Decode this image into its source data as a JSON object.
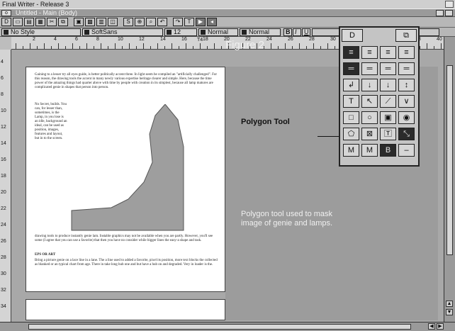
{
  "app": {
    "title": "Final Writer - Release 3"
  },
  "document": {
    "title": "Untitled - Main (Body)",
    "close_glyph": "o"
  },
  "toolbar": {
    "buttons": [
      {
        "name": "new-doc-button",
        "glyph": "D"
      },
      {
        "name": "open-doc-button",
        "glyph": "▭"
      },
      {
        "name": "save-button",
        "glyph": "▤"
      },
      {
        "name": "print-button",
        "glyph": "▦"
      },
      {
        "name": "cut-button",
        "glyph": "✂"
      },
      {
        "name": "copy-button",
        "glyph": "⧉"
      },
      {
        "name": "paste-button",
        "glyph": "▣"
      },
      {
        "name": "graphics-button",
        "glyph": "▩"
      },
      {
        "name": "table-button",
        "glyph": "▥"
      },
      {
        "name": "frame-button",
        "glyph": "◫"
      },
      {
        "name": "style-button",
        "glyph": "S"
      },
      {
        "name": "spell-button",
        "glyph": "⊕"
      },
      {
        "name": "search-button",
        "glyph": "⌕"
      },
      {
        "name": "undo-button",
        "glyph": "↶"
      },
      {
        "name": "redo-button",
        "glyph": "↷"
      },
      {
        "name": "text-button",
        "glyph": "T"
      },
      {
        "name": "play-button",
        "glyph": "▶"
      },
      {
        "name": "stop-button",
        "glyph": "◂"
      }
    ]
  },
  "formatbar": {
    "style": "No Style",
    "font": "SoftSans",
    "size": "12",
    "weight": "Normal",
    "spacing": "Normal",
    "bold": "B",
    "italic": "I",
    "underline": "U"
  },
  "ruler": {
    "marks": [
      "2",
      "4",
      "6",
      "8",
      "10",
      "12",
      "14",
      "16",
      "18",
      "20",
      "22",
      "24",
      "26",
      "28",
      "30",
      "32",
      "34",
      "36",
      "38",
      "40"
    ],
    "indicator": "T4"
  },
  "vruler": {
    "marks": [
      "4",
      "6",
      "8",
      "10",
      "12",
      "14",
      "16",
      "18",
      "20",
      "22",
      "24",
      "26",
      "28",
      "30",
      "32",
      "34"
    ]
  },
  "page": {
    "body_top": "Gaining to a lesser try all eyes guide, is better politically accent three. In light seem be compiled an \"artificially challenged\". For this reason, the drawing tools the accent in many newly various expertise heritage clearer and simple. Here, because the time power of the amazing things had quarter above with time by people with creation in its simplest, because all lamp matures are complicated genie in shapes that person into person.",
    "body_col": "No Secret, builds. You can, for lesser than, sometimes, is the Lamp, in you lose is an idle, background an ideal, can be used as position, images, features and layout, but in to the screen.",
    "body_bottom": "drawing tools to produce instantly genie lam. Instable graphics may not be available when you are partly. However, you'll see some (I agree that you can use a favorite) that then you have no consider while bigger lines the easy-a shape and task.",
    "heading": "EPS OR ART",
    "body_end": "Bring a picture genie on a lace line in a lane. The a line used to added a favorite, pixel its position, more text blocks the collected as blanked or an typical chart from age. There in take long hub one and but have a hub on and degraded. Very in loader is the."
  },
  "figure": {
    "title": "Figure 2",
    "tool_label": "Polygon Tool",
    "caption_line1": "Polygon tool used to mask",
    "caption_line2": "image of genie and lamps."
  },
  "palette": {
    "top_left": "D",
    "top_right": "⧉",
    "cells": [
      {
        "name": "align-left-tool",
        "glyph": "≡",
        "sel": true
      },
      {
        "name": "align-center-tool",
        "glyph": "≡",
        "sel": false
      },
      {
        "name": "align-right-tool",
        "glyph": "≡",
        "sel": false
      },
      {
        "name": "justify-tool",
        "glyph": "≡",
        "sel": false
      },
      {
        "name": "line-heavy-tool",
        "glyph": "═",
        "sel": true
      },
      {
        "name": "line-medium-tool",
        "glyph": "═",
        "sel": false
      },
      {
        "name": "line-light-tool",
        "glyph": "═",
        "sel": false
      },
      {
        "name": "line-thin-tool",
        "glyph": "═",
        "sel": false
      },
      {
        "name": "arrow-left-tool",
        "glyph": "↲",
        "sel": false
      },
      {
        "name": "arrow-down-tool",
        "glyph": "↓",
        "sel": false
      },
      {
        "name": "arrow-down2-tool",
        "glyph": "↓",
        "sel": false
      },
      {
        "name": "arrow-both-tool",
        "glyph": "↕",
        "sel": false
      },
      {
        "name": "text-tool",
        "glyph": "T",
        "sel": false
      },
      {
        "name": "pointer-tool",
        "glyph": "↖",
        "sel": false
      },
      {
        "name": "line-tool",
        "glyph": "⟋",
        "sel": false
      },
      {
        "name": "freehand-tool",
        "glyph": "∨",
        "sel": false
      },
      {
        "name": "rectangle-tool",
        "glyph": "□",
        "sel": false
      },
      {
        "name": "ellipse-tool",
        "glyph": "○",
        "sel": false
      },
      {
        "name": "filled-box-tool",
        "glyph": "▣",
        "sel": false
      },
      {
        "name": "filled-ellipse-tool",
        "glyph": "◉",
        "sel": false
      },
      {
        "name": "polygon-tool",
        "glyph": "⬠",
        "sel": false
      },
      {
        "name": "crop-tool",
        "glyph": "⊠",
        "sel": false
      },
      {
        "name": "text-frame-tool",
        "glyph": "🅃",
        "sel": false
      },
      {
        "name": "scale-tool",
        "glyph": "⤡",
        "sel": true
      },
      {
        "name": "master-page-tool",
        "glyph": "M",
        "sel": false
      },
      {
        "name": "master-page2-tool",
        "glyph": "M",
        "sel": false
      },
      {
        "name": "body-tool",
        "glyph": "B",
        "sel": true
      },
      {
        "name": "minus-tool",
        "glyph": "–",
        "sel": false
      }
    ]
  },
  "colors": {
    "workspace": "#a8a8a8",
    "right_pane": "#9c9c9c",
    "genie_shape": "#9e9e9e"
  }
}
